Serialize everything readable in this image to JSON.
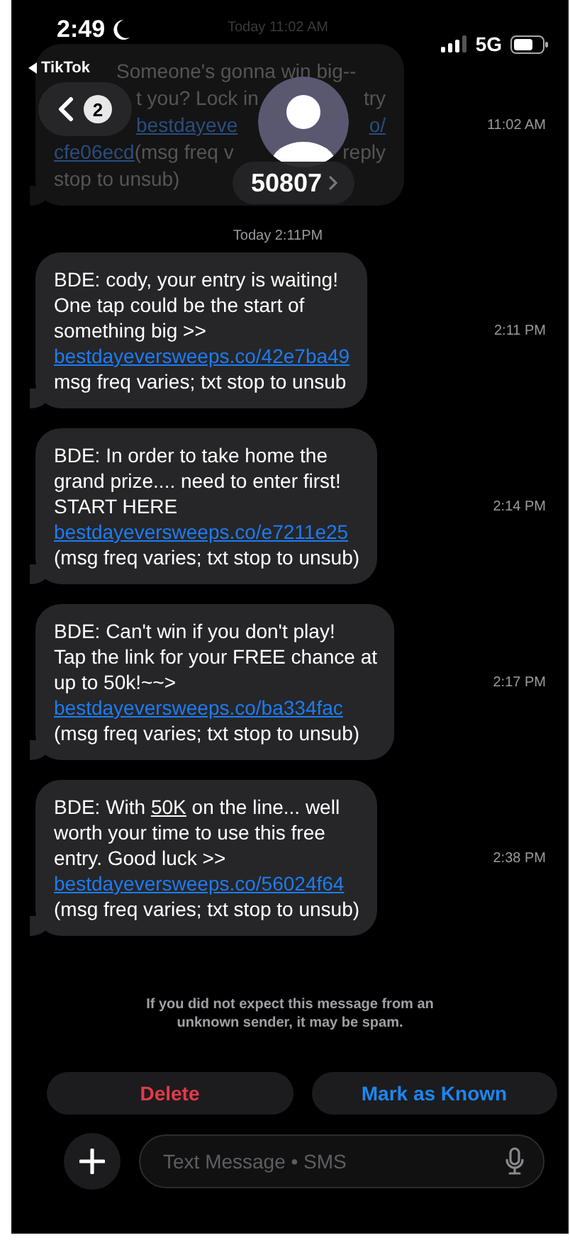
{
  "status_bar": {
    "time": "2:49",
    "back_app": "TikTok",
    "network": "5G"
  },
  "header": {
    "back_count": "2",
    "contact": "50807"
  },
  "earlier": {
    "day_time": "Today 11:02 AM",
    "time": "11:02 AM",
    "lines": [
      [
        {
          "text": "Someone's gonna win big--",
          "kind": "plain"
        }
      ],
      [
        {
          "text": "t you? Lock in",
          "kind": "plain"
        },
        {
          "text": "try",
          "kind": "plain"
        }
      ],
      [
        {
          "text": "bestdayeve",
          "kind": "link"
        },
        {
          "text": "o/",
          "kind": "link"
        }
      ],
      [
        {
          "text": "cfe06ecd",
          "kind": "link"
        },
        {
          "text": " (msg freq v",
          "kind": "plain"
        },
        {
          "text": "reply",
          "kind": "plain"
        }
      ],
      [
        {
          "text": "stop to unsub)",
          "kind": "plain"
        }
      ]
    ]
  },
  "day_time": "Today 2:11PM",
  "messages": [
    {
      "time": "2:11 PM",
      "lines": [
        [
          {
            "text": "BDE: cody, your entry is waiting!",
            "kind": "plain"
          }
        ],
        [
          {
            "text": "One tap could be the start of",
            "kind": "plain"
          }
        ],
        [
          {
            "text": "something big >>",
            "kind": "plain"
          }
        ],
        [
          {
            "text": "bestdayeversweeps.co/42e7ba49",
            "kind": "link"
          }
        ],
        [
          {
            "text": "msg freq varies; txt stop to unsub",
            "kind": "plain"
          }
        ]
      ]
    },
    {
      "time": "2:14 PM",
      "lines": [
        [
          {
            "text": "BDE: In order to take home the",
            "kind": "plain"
          }
        ],
        [
          {
            "text": "grand prize.... need to enter first!",
            "kind": "plain"
          }
        ],
        [
          {
            "text": "START HERE",
            "kind": "plain"
          }
        ],
        [
          {
            "text": "bestdayeversweeps.co/e7211e25",
            "kind": "link"
          }
        ],
        [
          {
            "text": "(msg freq varies; txt stop to unsub)",
            "kind": "plain"
          }
        ]
      ]
    },
    {
      "time": "2:17 PM",
      "lines": [
        [
          {
            "text": "BDE: Can't win if you don't play!",
            "kind": "plain"
          }
        ],
        [
          {
            "text": "Tap the link for your FREE chance at",
            "kind": "plain"
          }
        ],
        [
          {
            "text": "up to 50k!~~>",
            "kind": "plain"
          }
        ],
        [
          {
            "text": "bestdayeversweeps.co/ba334fac",
            "kind": "link"
          }
        ],
        [
          {
            "text": "(msg freq varies; txt stop to unsub)",
            "kind": "plain"
          }
        ]
      ]
    },
    {
      "time": "2:38 PM",
      "lines": [
        [
          {
            "text": "BDE: With ",
            "kind": "plain"
          },
          {
            "text": "50K",
            "kind": "underline"
          },
          {
            "text": " on the line... well",
            "kind": "plain"
          }
        ],
        [
          {
            "text": "worth your time to use this free",
            "kind": "plain"
          }
        ],
        [
          {
            "text": "entry. Good luck >>",
            "kind": "plain"
          }
        ],
        [
          {
            "text": "bestdayeversweeps.co/56024f64",
            "kind": "link"
          }
        ],
        [
          {
            "text": "(msg freq varies; txt stop to unsub)",
            "kind": "plain"
          }
        ]
      ]
    }
  ],
  "spam_notice": [
    "If you did not expect this message from an",
    "unknown sender, it may be spam."
  ],
  "actions": [
    {
      "label": "Delete",
      "kind": "destructive"
    },
    {
      "label": "Mark as Known",
      "kind": "primary"
    }
  ],
  "composer": {
    "placeholder": "Text Message • SMS"
  }
}
